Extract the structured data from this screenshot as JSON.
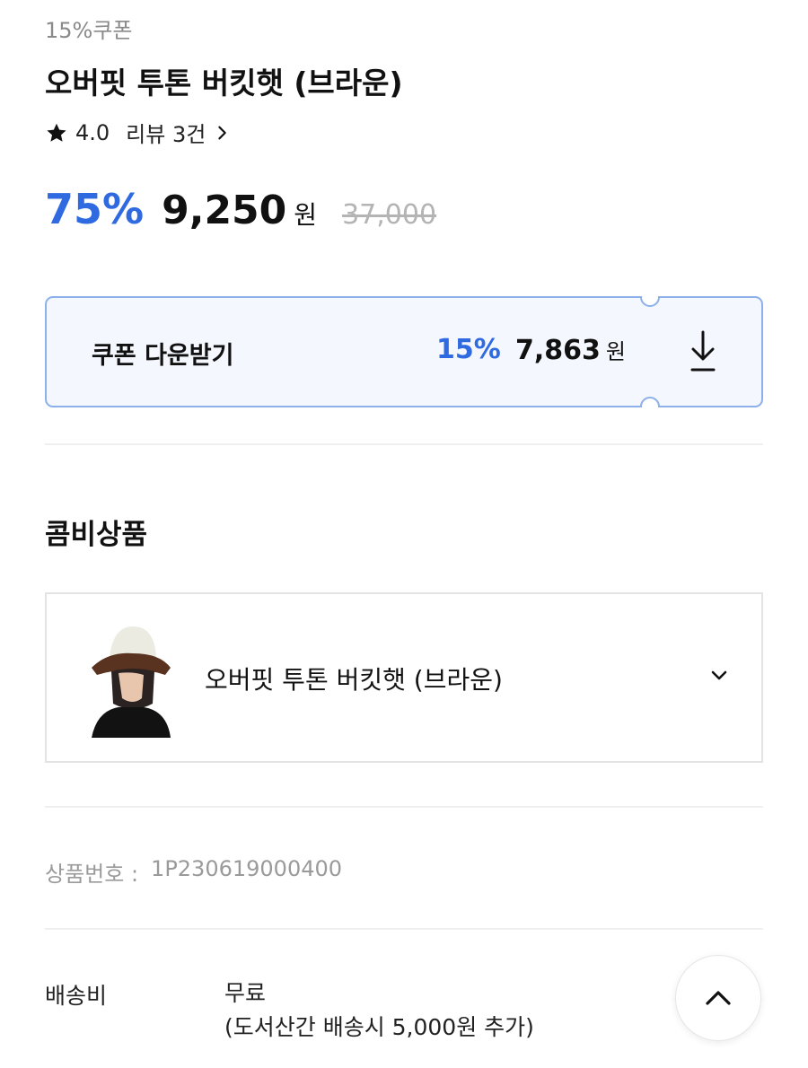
{
  "product": {
    "coupon_tag": "15%쿠폰",
    "title": "오버핏 투톤 버킷햇 (브라운)",
    "rating": "4.0",
    "review_text": "리뷰 3건",
    "discount_rate": "75%",
    "price": "9,250",
    "currency": "원",
    "original_price": "37,000"
  },
  "coupon": {
    "label": "쿠폰 다운받기",
    "rate": "15%",
    "price": "7,863",
    "currency": "원"
  },
  "combo": {
    "section_title": "콤비상품",
    "item_name": "오버핏 투톤 버킷햇 (브라운)"
  },
  "info": {
    "product_no_label": "상품번호 :",
    "product_no": "1P230619000400"
  },
  "shipping": {
    "label": "배송비",
    "value_line1": "무료",
    "value_line2": "(도서산간 배송시 5,000원 추가)"
  },
  "icons": {
    "star": "star-icon",
    "review_chevron": "chevron-right-icon",
    "download": "download-icon",
    "dropdown": "chevron-down-icon",
    "scroll_top": "chevron-up-icon"
  },
  "colors": {
    "accent": "#2f6ae0",
    "coupon_bg": "#f4f7fd",
    "coupon_border": "#8db0ea",
    "muted": "#9a9a9a"
  }
}
